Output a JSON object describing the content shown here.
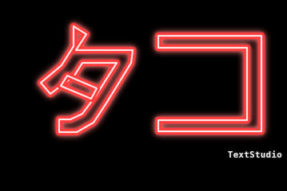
{
  "artwork": {
    "text": "タコ",
    "style": "red neon outline glow on black",
    "colors": {
      "background": "#000000",
      "glow": "#ff2a2a",
      "stroke_outer": "#ff4444",
      "stroke_inner": "#ffe6e6"
    }
  },
  "watermark": {
    "text": "TextStudio"
  }
}
